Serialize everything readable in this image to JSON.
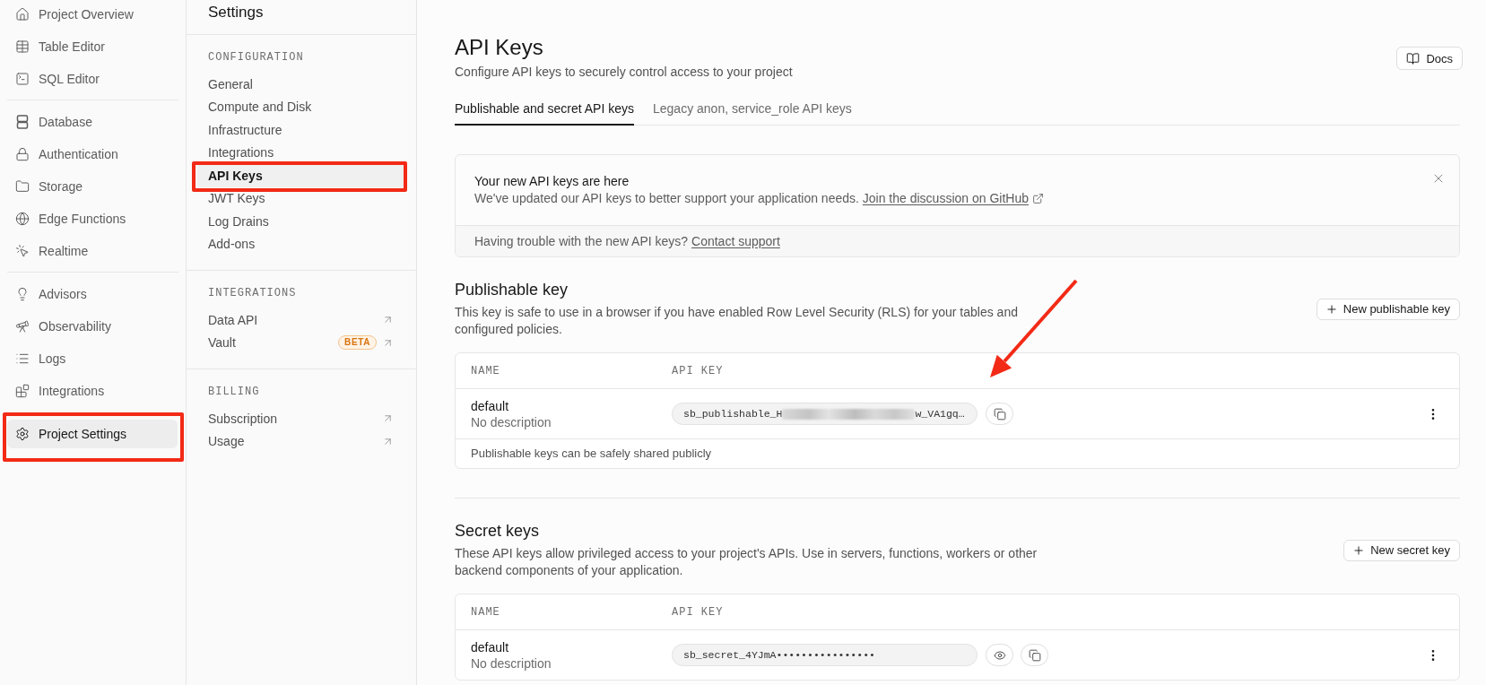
{
  "nav": {
    "groups": [
      [
        {
          "label": "Project Overview",
          "selected": false,
          "annotated": false
        },
        {
          "label": "Table Editor",
          "selected": false,
          "annotated": false
        },
        {
          "label": "SQL Editor",
          "selected": false,
          "annotated": false
        }
      ],
      [
        {
          "label": "Database",
          "selected": false,
          "annotated": false
        },
        {
          "label": "Authentication",
          "selected": false,
          "annotated": false
        },
        {
          "label": "Storage",
          "selected": false,
          "annotated": false
        },
        {
          "label": "Edge Functions",
          "selected": false,
          "annotated": false
        },
        {
          "label": "Realtime",
          "selected": false,
          "annotated": false
        }
      ],
      [
        {
          "label": "Advisors",
          "selected": false,
          "annotated": false
        },
        {
          "label": "Observability",
          "selected": false,
          "annotated": false
        },
        {
          "label": "Logs",
          "selected": false,
          "annotated": false
        },
        {
          "label": "Integrations",
          "selected": false,
          "annotated": false
        }
      ]
    ],
    "footer_item": {
      "label": "Project Settings",
      "selected": true,
      "annotated": true
    }
  },
  "settings": {
    "title": "Settings",
    "sections": [
      {
        "heading": "CONFIGURATION",
        "items": [
          {
            "label": "General",
            "selected": false,
            "annotated": false,
            "external": false
          },
          {
            "label": "Compute and Disk",
            "selected": false,
            "annotated": false,
            "external": false
          },
          {
            "label": "Infrastructure",
            "selected": false,
            "annotated": false,
            "external": false
          },
          {
            "label": "Integrations",
            "selected": false,
            "annotated": false,
            "external": false
          },
          {
            "label": "API Keys",
            "selected": true,
            "annotated": true,
            "external": false
          },
          {
            "label": "JWT Keys",
            "selected": false,
            "annotated": false,
            "external": false
          },
          {
            "label": "Log Drains",
            "selected": false,
            "annotated": false,
            "external": false
          },
          {
            "label": "Add-ons",
            "selected": false,
            "annotated": false,
            "external": false
          }
        ]
      },
      {
        "heading": "INTEGRATIONS",
        "items": [
          {
            "label": "Data API",
            "selected": false,
            "annotated": false,
            "external": true
          },
          {
            "label": "Vault",
            "selected": false,
            "annotated": false,
            "external": true,
            "badge": "BETA"
          }
        ]
      },
      {
        "heading": "BILLING",
        "items": [
          {
            "label": "Subscription",
            "selected": false,
            "annotated": false,
            "external": true
          },
          {
            "label": "Usage",
            "selected": false,
            "annotated": false,
            "external": true
          }
        ]
      }
    ]
  },
  "page": {
    "title": "API Keys",
    "subtitle": "Configure API keys to securely control access to your project",
    "docs_button": "Docs",
    "tabs": [
      {
        "label": "Publishable and secret API keys",
        "selected": true
      },
      {
        "label": "Legacy anon, service_role API keys",
        "selected": false
      }
    ],
    "notice": {
      "title": "Your new API keys are here",
      "body": "We've updated our API keys to better support your application needs.",
      "link": "Join the discussion on GitHub",
      "footer": "Having trouble with the new API keys?",
      "footer_link": "Contact support"
    },
    "key_sections": [
      {
        "title": "Publishable key",
        "description": "This key is safe to use in a browser if you have enabled Row Level Security (RLS) for your tables and configured policies.",
        "button": "New publishable key",
        "columns": [
          "NAME",
          "API KEY"
        ],
        "rows": [
          {
            "kind": "publishable",
            "name": "default",
            "description": "No description",
            "key_start": "sb_publishable_H",
            "key_end": "w_VA1gq…",
            "blurred": true
          }
        ],
        "footnote": "Publishable keys can be safely shared publicly"
      },
      {
        "title": "Secret keys",
        "description": "These API keys allow privileged access to your project's APIs. Use in servers, functions, workers or other backend components of your application.",
        "button": "New secret key",
        "columns": [
          "NAME",
          "API KEY"
        ],
        "rows": [
          {
            "kind": "secret",
            "name": "default",
            "description": "No description",
            "key_start": "sb_secret_4YJmA••••••••••••••••",
            "blurred": false
          }
        ]
      }
    ]
  },
  "annotation_arrow": true
}
